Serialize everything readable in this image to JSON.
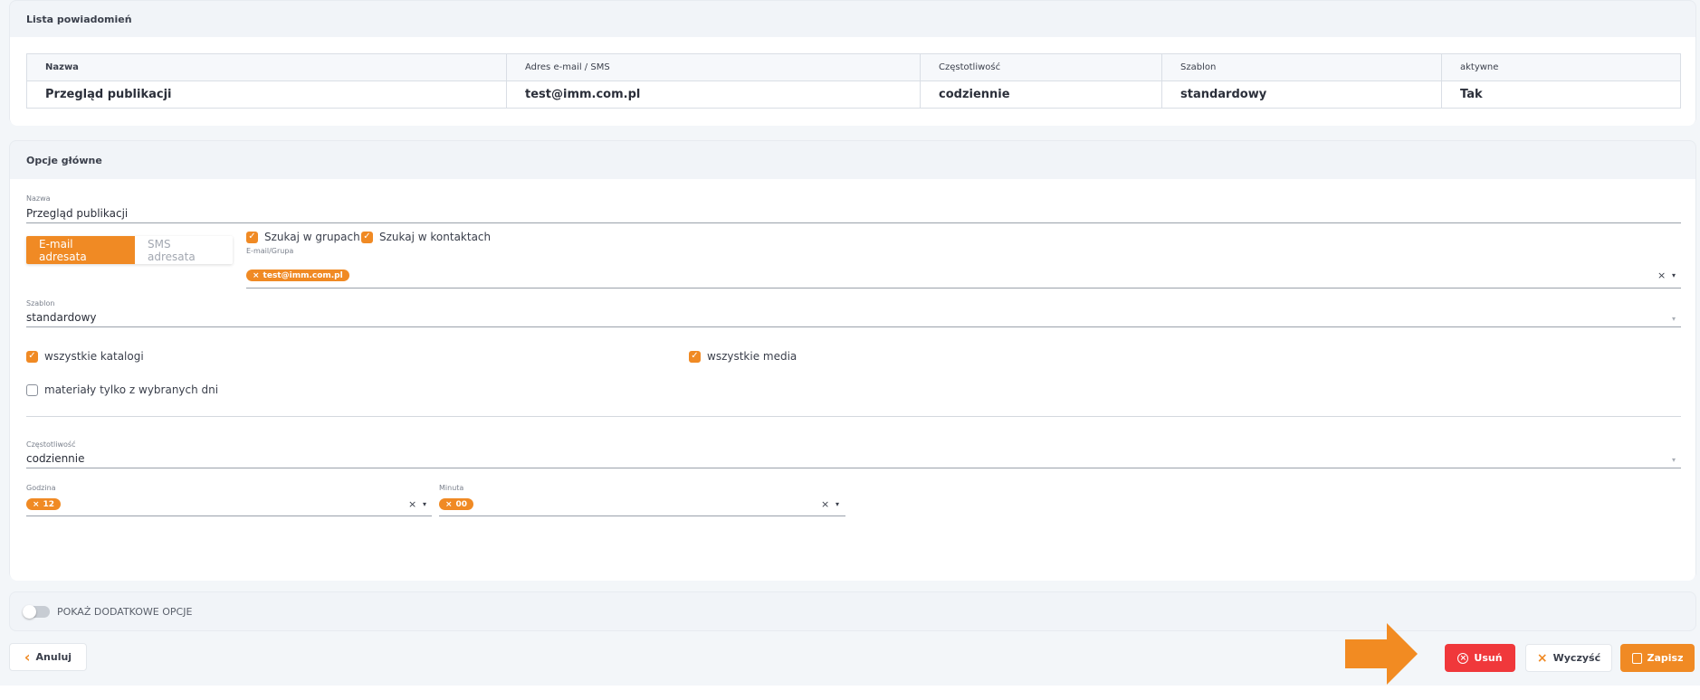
{
  "notifications": {
    "title": "Lista powiadomień",
    "columns": [
      "Nazwa",
      "Adres e-mail / SMS",
      "Częstotliwość",
      "Szablon",
      "aktywne"
    ],
    "rows": [
      [
        "Przegląd publikacji",
        "test@imm.com.pl",
        "codziennie",
        "standardowy",
        "Tak"
      ]
    ]
  },
  "main_options": {
    "title": "Opcje główne",
    "name_label": "Nazwa",
    "name_value": "Przegląd publikacji",
    "recipient_tabs": [
      "E-mail adresata",
      "SMS adresata"
    ],
    "search_groups": "Szukaj w grupach",
    "search_contacts": "Szukaj w kontaktach",
    "email_group_label": "E-mail/Grupa",
    "email_chip": "test@imm.com.pl",
    "template_label": "Szablon",
    "template_value": "standardowy",
    "all_catalogs": "wszystkie katalogi",
    "all_media": "wszystkie media",
    "selected_days": "materiały tylko z wybranych dni",
    "frequency_label": "Częstotliwość",
    "frequency_value": "codziennie",
    "hour_label": "Godzina",
    "hour_chip": "12",
    "minute_label": "Minuta",
    "minute_chip": "00"
  },
  "extra": {
    "toggle_label": "POKAŻ DODATKOWE OPCJE"
  },
  "footer": {
    "cancel": "Anuluj",
    "delete": "Usuń",
    "clear": "Wyczyść",
    "save": "Zapisz"
  },
  "colors": {
    "accent": "#f08a24",
    "danger": "#f0383b",
    "arrow": "#f28b22"
  },
  "icons": {
    "chevron_left": "‹",
    "close": "×",
    "caret": "▾",
    "check": "✓"
  }
}
